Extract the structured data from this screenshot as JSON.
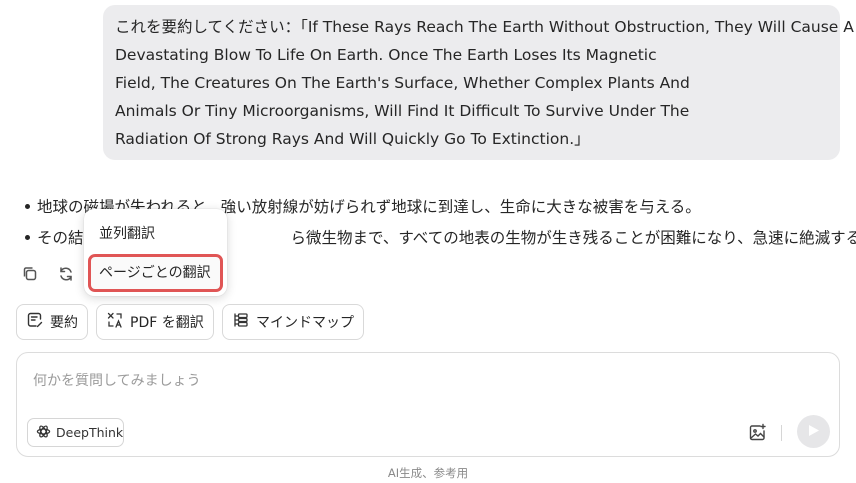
{
  "user_message": {
    "lines": [
      "これを要約してください：「If These Rays Reach The Earth Without Obstruction, They Will Cause A",
      "Devastating Blow To Life On Earth. Once The Earth Loses Its Magnetic",
      "Field, The Creatures On The Earth's Surface, Whether Complex Plants And",
      "Animals Or Tiny Microorganisms, Will Find It Difficult To Survive Under The",
      "Radiation Of Strong Rays And Will Quickly Go To Extinction.」"
    ]
  },
  "answer": {
    "bullets": [
      {
        "prefix": "地球の磁場が失われると",
        "rest": "強い放射線が妨げられず地球に到達し、生命に大きな被害を与える。"
      },
      {
        "prefix": "その結",
        "rest": "ら微生物まで、すべての地表の生物が生き残ることが困難になり、急速に絶滅する。"
      }
    ]
  },
  "actions": {
    "copy_icon": "copy-icon",
    "regenerate_icon": "refresh-icon"
  },
  "translate_menu": {
    "items": [
      "並列翻訳",
      "ページごとの翻訳"
    ],
    "highlighted_index": 1,
    "highlight_color": "#e05555"
  },
  "tools": {
    "summarize": "要約",
    "translate_pdf": "PDF を翻訳",
    "mind_map": "マインドマップ"
  },
  "composer": {
    "placeholder": "何かを質問してみましょう",
    "deepthink_label": "DeepThink"
  },
  "footer_note": "AI生成、参考用"
}
